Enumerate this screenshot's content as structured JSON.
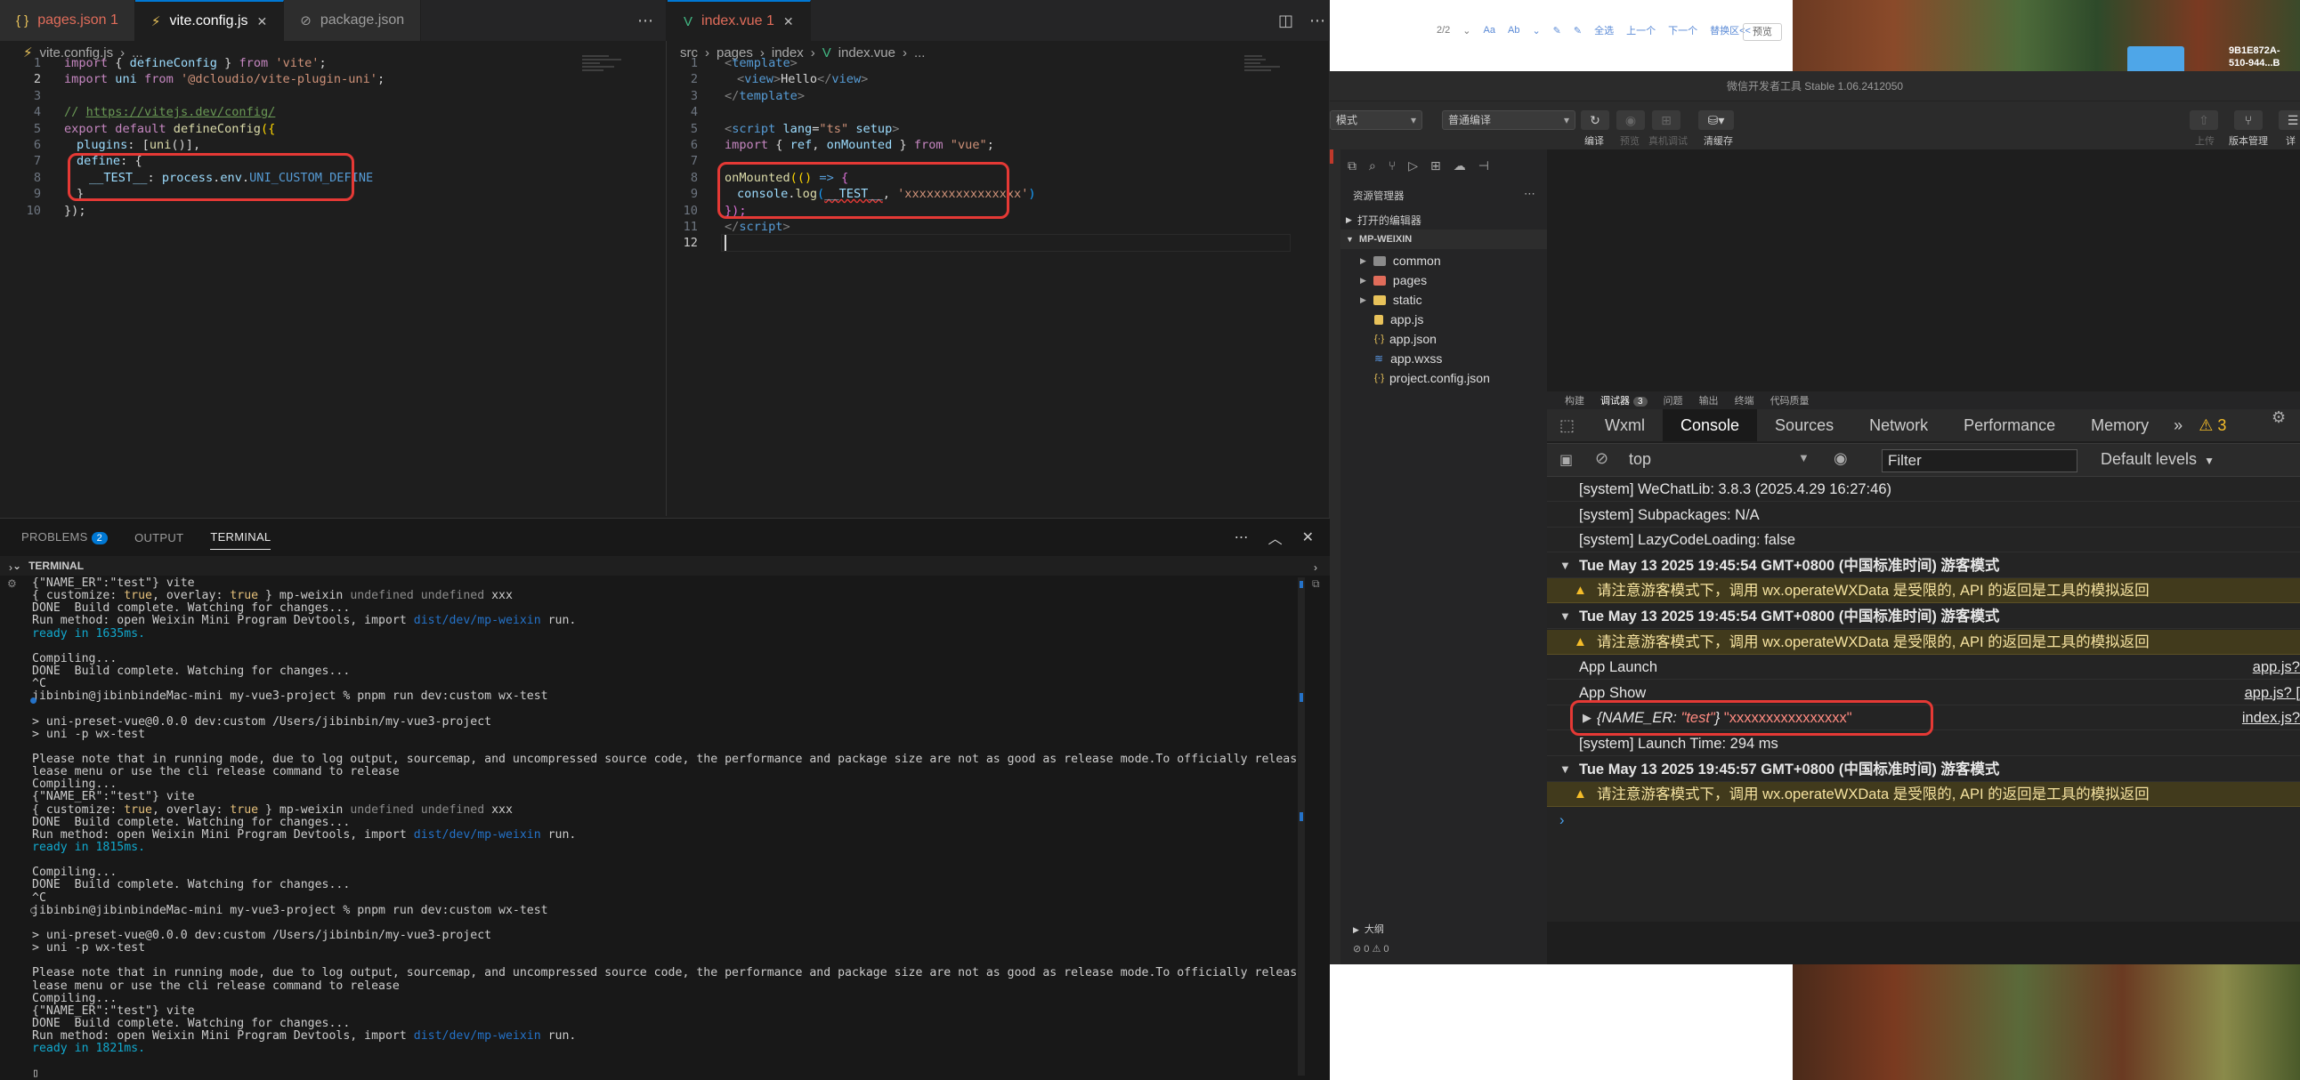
{
  "left_editor": {
    "tabs": [
      {
        "label": "pages.json 1",
        "icon": "{ }"
      },
      {
        "label": "vite.config.js",
        "icon": "⚡"
      },
      {
        "label": "package.json",
        "icon": "⊘"
      }
    ],
    "breadcrumb": [
      "vite.config.js",
      "..."
    ],
    "line_numbers": [
      "1",
      "2",
      "3",
      "4",
      "5",
      "6",
      "7",
      "8",
      "9",
      "10"
    ],
    "code": {
      "l1": [
        "import",
        " { ",
        "defineConfig",
        " } ",
        "from",
        " ",
        "'vite'",
        ";"
      ],
      "l2": [
        "import",
        " ",
        "uni",
        " ",
        "from",
        " ",
        "'@dcloudio/vite-plugin-uni'",
        ";"
      ],
      "l4": [
        "// ",
        "https://vitejs.dev/config/"
      ],
      "l5": [
        "export",
        " ",
        "default",
        " ",
        "defineConfig",
        "({"
      ],
      "l6": [
        "plugins",
        ": [",
        "uni",
        "()],"
      ],
      "l7": [
        "define",
        ": {"
      ],
      "l8": [
        "__TEST__",
        ": ",
        "process",
        ".",
        "env",
        ".",
        "UNI_CUSTOM_DEFINE"
      ],
      "l9": [
        "}"
      ],
      "l10": [
        "});"
      ]
    }
  },
  "right_editor": {
    "tab": {
      "label": "index.vue 1",
      "icon": "V"
    },
    "breadcrumb": [
      "src",
      "pages",
      "index",
      "index.vue",
      "..."
    ],
    "line_numbers": [
      "1",
      "2",
      "3",
      "4",
      "5",
      "6",
      "7",
      "8",
      "9",
      "10",
      "11",
      "12"
    ],
    "code": {
      "l1": [
        "<",
        "template",
        ">"
      ],
      "l2": [
        "<",
        "view",
        ">",
        "Hello",
        "</",
        "view",
        ">"
      ],
      "l3": [
        "</",
        "template",
        ">"
      ],
      "l5": [
        "<",
        "script",
        " ",
        "lang",
        "=",
        "\"ts\"",
        " ",
        "setup",
        ">"
      ],
      "l6": [
        "import",
        " { ",
        "ref",
        ", ",
        "onMounted",
        " } ",
        "from",
        " ",
        "\"vue\"",
        ";"
      ],
      "l8": [
        "onMounted",
        "(() ",
        "=>",
        " {"
      ],
      "l9": [
        "console",
        ".",
        "log",
        "(",
        "__TEST__",
        ", ",
        "'xxxxxxxxxxxxxxxx'",
        ")"
      ],
      "l10": [
        "});"
      ],
      "l11": [
        "</",
        "script",
        ">"
      ]
    }
  },
  "panel": {
    "tabs": [
      {
        "label": "PROBLEMS",
        "badge": "2"
      },
      {
        "label": "OUTPUT"
      },
      {
        "label": "TERMINAL"
      }
    ],
    "section_title": "TERMINAL",
    "terminal_lines": [
      "{\"NAME_ER\":\"test\"} vite",
      "{ customize: true, overlay: true } mp-weixin undefined undefined xxx",
      "DONE  Build complete. Watching for changes...",
      "Run method: open Weixin Mini Program Devtools, import dist/dev/mp-weixin run.",
      "ready in 1635ms.",
      "",
      "Compiling...",
      "DONE  Build complete. Watching for changes...",
      "^C",
      "jibinbin@jibinbindeMac-mini my-vue3-project % pnpm run dev:custom wx-test",
      "",
      "> uni-preset-vue@0.0.0 dev:custom /Users/jibinbin/my-vue3-project",
      "> uni -p wx-test",
      "",
      "Please note that in running mode, due to log output, sourcemap, and uncompressed source code, the performance and package size are not as good as release mode.To officially release, please click the re",
      "lease menu or use the cli release command to release",
      "Compiling...",
      "{\"NAME_ER\":\"test\"} vite",
      "{ customize: true, overlay: true } mp-weixin undefined undefined xxx",
      "DONE  Build complete. Watching for changes...",
      "Run method: open Weixin Mini Program Devtools, import dist/dev/mp-weixin run.",
      "ready in 1815ms.",
      "",
      "Compiling...",
      "DONE  Build complete. Watching for changes...",
      "^C",
      "jibinbin@jibinbindeMac-mini my-vue3-project % pnpm run dev:custom wx-test",
      "",
      "> uni-preset-vue@0.0.0 dev:custom /Users/jibinbin/my-vue3-project",
      "> uni -p wx-test",
      "",
      "Please note that in running mode, due to log output, sourcemap, and uncompressed source code, the performance and package size are not as good as release mode.To officially release, please click the re",
      "lease menu or use the cli release command to release",
      "Compiling...",
      "{\"NAME_ER\":\"test\"} vite",
      "DONE  Build complete. Watching for changes...",
      "Run method: open Weixin Mini Program Devtools, import dist/dev/mp-weixin run.",
      "ready in 1821ms.",
      "",
      "▯"
    ]
  },
  "doc_bar": {
    "items": [
      "2/2",
      "⌄",
      "Aa",
      "Ab",
      "⌄",
      "✎",
      "✎",
      "全选",
      "上一个",
      "下一个",
      "替换区<<"
    ],
    "preview_button": "预览"
  },
  "desktop": {
    "file_label_line1": "9B1E872A-",
    "file_label_line2": "510-944...B"
  },
  "devtools": {
    "window_title": "微信开发者工具 Stable 1.06.2412050",
    "toolbar": {
      "mode_select": "模式",
      "compile_select": "普通编译",
      "buttons": [
        {
          "label": "编译",
          "dim": false
        },
        {
          "label": "预览",
          "dim": true
        },
        {
          "label": "真机调试",
          "dim": true
        },
        {
          "label": "清缓存",
          "dim": false
        }
      ],
      "right_buttons": [
        {
          "label": "上传",
          "dim": true
        },
        {
          "label": "版本管理",
          "dim": false
        },
        {
          "label": "详",
          "dim": false
        }
      ]
    },
    "explorer": {
      "title": "资源管理器",
      "open_editors": "打开的编辑器",
      "project": "MP-WEIXIN",
      "items": [
        {
          "label": "common",
          "type": "folder",
          "color": "#8a8a8a"
        },
        {
          "label": "pages",
          "type": "folder",
          "color": "#e06c5a"
        },
        {
          "label": "static",
          "type": "folder",
          "color": "#e8c25a"
        },
        {
          "label": "app.js",
          "type": "file",
          "color": "#e8c25a"
        },
        {
          "label": "app.json",
          "type": "file",
          "color": "#e8c25a"
        },
        {
          "label": "app.wxss",
          "type": "file",
          "color": "#5a9ae8"
        },
        {
          "label": "project.config.json",
          "type": "file",
          "color": "#e8c25a"
        }
      ],
      "outline": "大纲",
      "status": "⊘ 0 ⚠ 0"
    },
    "debug_tabs": [
      {
        "label": "构建"
      },
      {
        "label": "调试器",
        "count": "3"
      },
      {
        "label": "问题"
      },
      {
        "label": "输出"
      },
      {
        "label": "终端"
      },
      {
        "label": "代码质量"
      }
    ],
    "devtool_tabs": [
      "Wxml",
      "Console",
      "Sources",
      "Network",
      "Performance",
      "Memory",
      "»",
      "⚠ 3"
    ],
    "filter": {
      "context": "top",
      "placeholder": "Filter",
      "levels": "Default levels"
    },
    "console_lines": [
      {
        "text": "[system] WeChatLib: 3.8.3 (2025.4.29 16:27:46)",
        "kind": "log"
      },
      {
        "text": "[system] Subpackages: N/A",
        "kind": "log"
      },
      {
        "text": "[system] LazyCodeLoading: false",
        "kind": "log"
      },
      {
        "text": "Tue May 13 2025 19:45:54 GMT+0800 (中国标准时间) 游客模式",
        "kind": "group"
      },
      {
        "text": "请注意游客模式下，调用 wx.operateWXData 是受限的, API 的返回是工具的模拟返回",
        "kind": "warn"
      },
      {
        "text": "Tue May 13 2025 19:45:54 GMT+0800 (中国标准时间) 游客模式",
        "kind": "group"
      },
      {
        "text": "请注意游客模式下，调用 wx.operateWXData 是受限的, API 的返回是工具的模拟返回",
        "kind": "warn"
      },
      {
        "text": "App Launch",
        "kind": "log",
        "link": "app.js?"
      },
      {
        "text": "App Show",
        "kind": "log",
        "link": "app.js? ["
      },
      {
        "text": "{NAME_ER: \"test\"} \"xxxxxxxxxxxxxxxx\"",
        "kind": "obj",
        "link": "index.js?"
      },
      {
        "text": "[system] Launch Time: 294 ms",
        "kind": "log"
      },
      {
        "text": "Tue May 13 2025 19:45:57 GMT+0800 (中国标准时间) 游客模式",
        "kind": "group"
      },
      {
        "text": "请注意游客模式下，调用 wx.operateWXData 是受限的, API 的返回是工具的模拟返回",
        "kind": "warn"
      },
      {
        "text": "›",
        "kind": "prompt"
      }
    ]
  }
}
